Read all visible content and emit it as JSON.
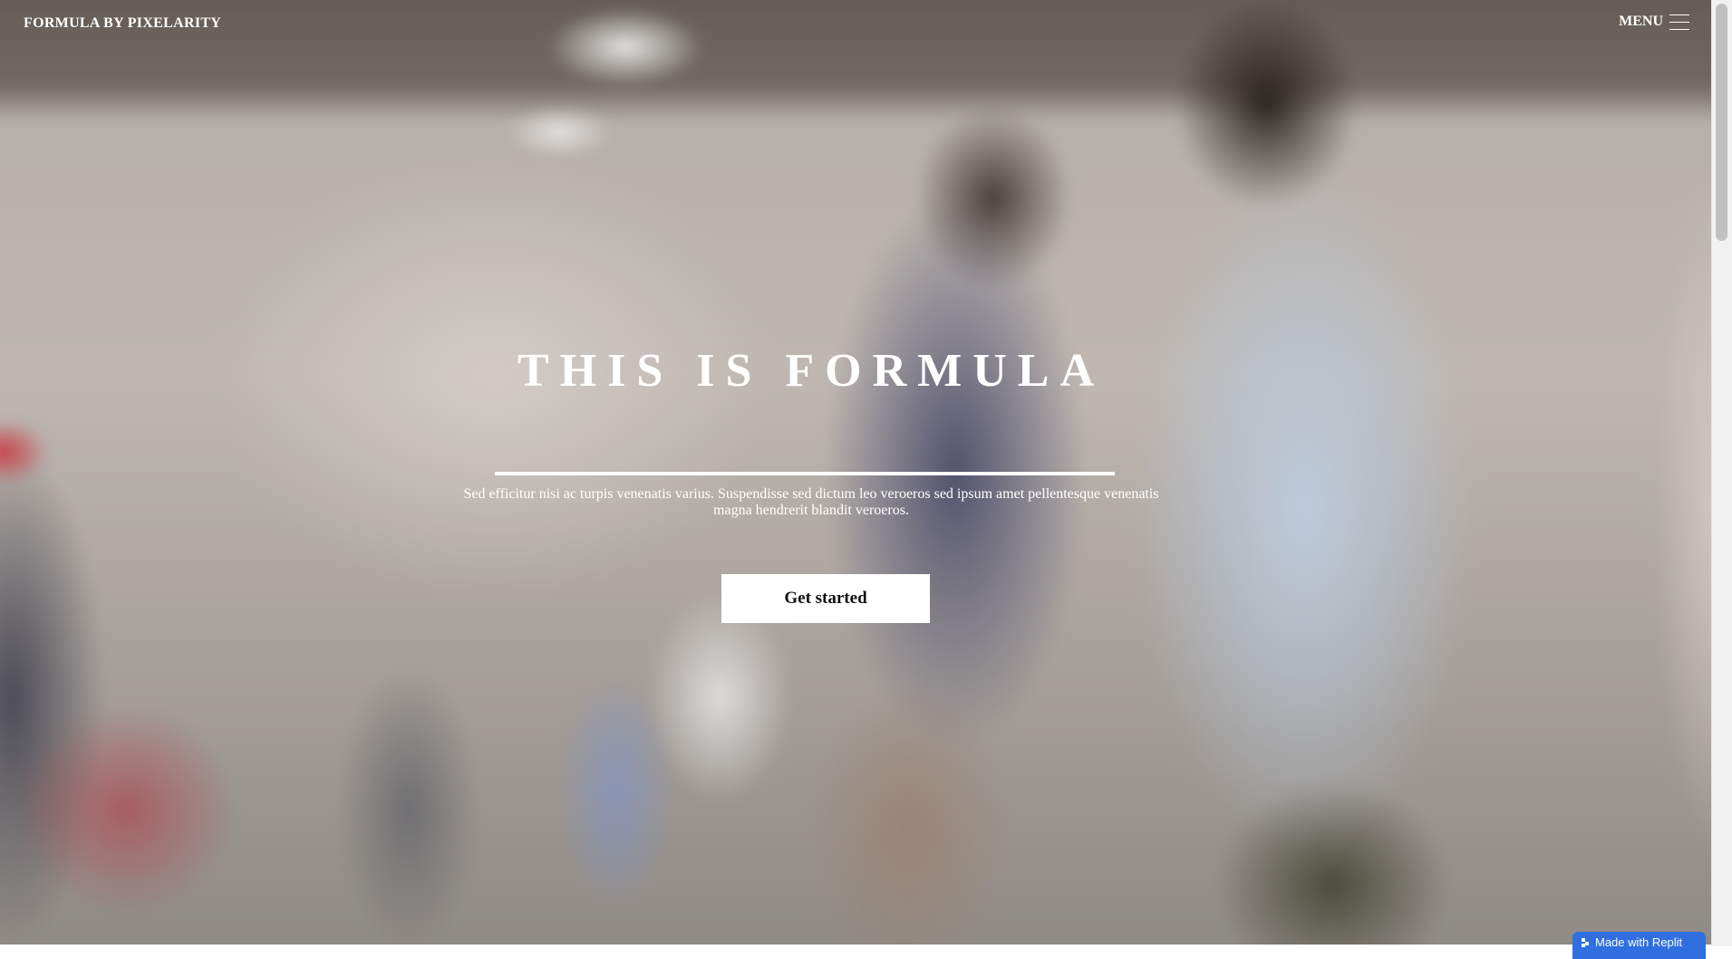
{
  "header": {
    "site_title": "FORMULA BY PIXELARITY",
    "menu_label": "MENU",
    "menu_icon": "hamburger-icon"
  },
  "hero": {
    "title": "THIS IS FORMULA",
    "description": "Sed efficitur nisi ac turpis venenatis varius. Suspendisse sed dictum leo veroeros sed ipsum amet pellentesque venenatis magna hendrerit blandit veroeros.",
    "cta_label": "Get started"
  },
  "badge": {
    "label": "Made with Replit",
    "icon": "replit-icon",
    "color": "#2f6fe0"
  },
  "colors": {
    "text": "#ffffff",
    "button_bg": "#ffffff",
    "button_text": "#111111"
  }
}
